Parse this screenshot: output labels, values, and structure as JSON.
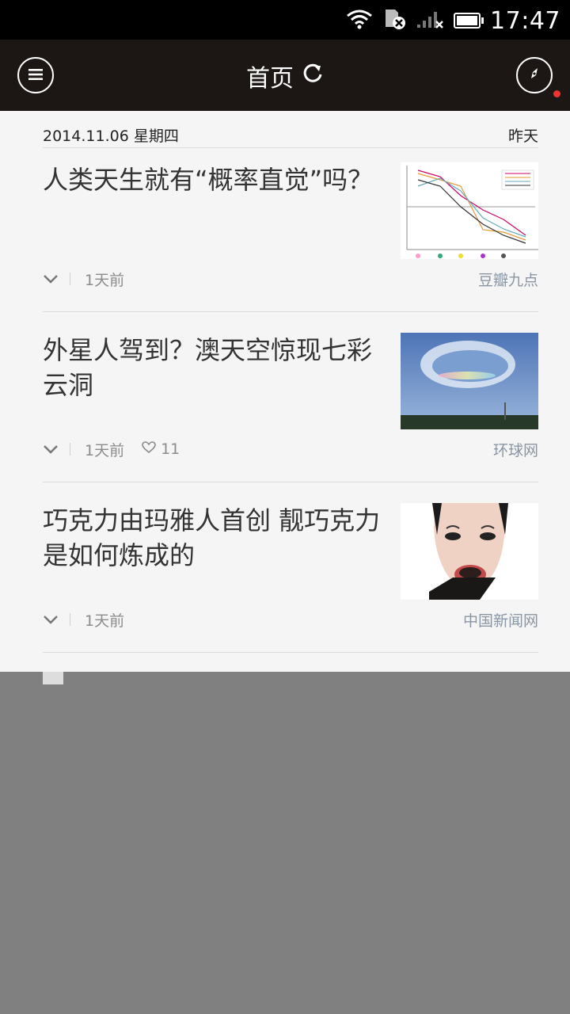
{
  "status_bar": {
    "time": "17:47",
    "icons": [
      "wifi-icon",
      "sim-off-icon",
      "signal-off-icon",
      "battery-icon"
    ]
  },
  "app_bar": {
    "title": "首页",
    "left_icon": "menu-icon",
    "refresh_icon": "refresh-icon",
    "right_icon": "compass-icon",
    "notification_color": "#e33333"
  },
  "date_row": {
    "date": "2014.11.06 星期四",
    "relative": "昨天"
  },
  "articles": [
    {
      "title": "人类天生就有“概率直觉”吗？",
      "time": "1天前",
      "likes": "",
      "source": "豆瓣九点",
      "thumb": "chart-thumbnail"
    },
    {
      "title": "外星人驾到？澳天空惊现七彩云洞",
      "time": "1天前",
      "likes": "11",
      "source": "环球网",
      "thumb": "sky-cloud-hole-thumbnail"
    },
    {
      "title": "巧克力由玛雅人首创 靓巧克力是如何炼成的",
      "time": "1天前",
      "likes": "",
      "source": "中国新闻网",
      "thumb": "woman-chocolate-thumbnail"
    }
  ]
}
